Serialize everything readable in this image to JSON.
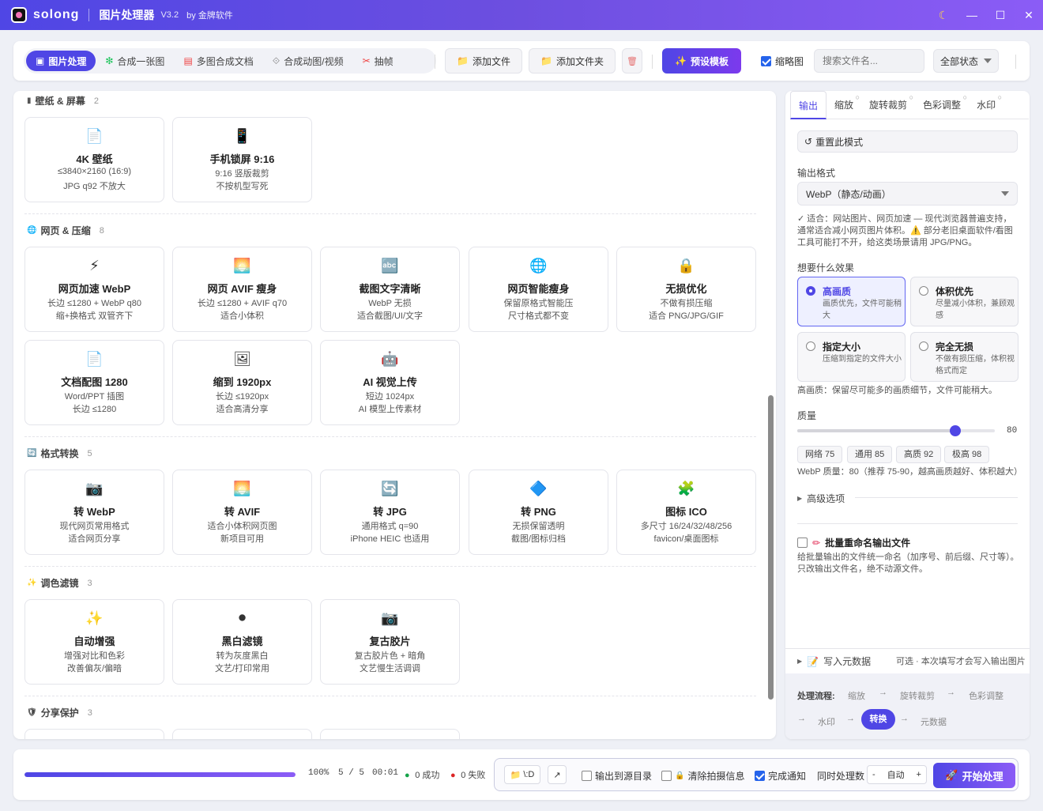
{
  "app": {
    "brand": "solong",
    "title": "图片处理器",
    "version": "V3.2",
    "by": "by 金牌软件"
  },
  "window": {
    "theme_glyph": "☾",
    "min_glyph": "—",
    "max_glyph": "☐",
    "close_glyph": "✕"
  },
  "modes": [
    {
      "label": "图片处理",
      "icon": "▣",
      "active": true
    },
    {
      "label": "合成一张图",
      "icon": "❇"
    },
    {
      "label": "多图合成文档",
      "icon": "▤"
    },
    {
      "label": "合成动图/视频",
      "icon": "⟐"
    },
    {
      "label": "抽帧",
      "icon": "✂"
    }
  ],
  "toolbar": {
    "add_file": "添加文件",
    "add_folder": "添加文件夹",
    "delete_glyph": "🗑",
    "preset": "预设模板",
    "thumb": "缩略图",
    "search_placeholder": "搜索文件名...",
    "status": "全部状态"
  },
  "sections": [
    {
      "title": "壁纸 & 屏幕",
      "count": "2",
      "icon": "▮",
      "cards": [
        {
          "icon": "📄",
          "title": "4K 壁纸",
          "d1": "≤3840×2160 (16:9)",
          "d2": "JPG q92 不放大"
        },
        {
          "icon": "📱",
          "title": "手机锁屏 9:16",
          "d1": "9:16 竖版裁剪",
          "d2": "不按机型写死"
        }
      ]
    },
    {
      "title": "网页 & 压缩",
      "count": "8",
      "icon": "🌐",
      "cards": [
        {
          "icon": "⚡",
          "title": "网页加速 WebP",
          "d1": "长边 ≤1280 + WebP q80",
          "d2": "缩+换格式 双管齐下"
        },
        {
          "icon": "🌅",
          "title": "网页 AVIF 瘦身",
          "d1": "长边 ≤1280 + AVIF q70",
          "d2": "适合小体积"
        },
        {
          "icon": "🔤",
          "title": "截图文字清晰",
          "d1": "WebP 无损",
          "d2": "适合截图/UI/文字"
        },
        {
          "icon": "🌐",
          "title": "网页智能瘦身",
          "d1": "保留原格式智能压",
          "d2": "尺寸格式都不变"
        },
        {
          "icon": "🔒",
          "title": "无损优化",
          "d1": "不做有损压缩",
          "d2": "适合 PNG/JPG/GIF"
        },
        {
          "icon": "📄",
          "title": "文档配图 1280",
          "d1": "Word/PPT 插图",
          "d2": "长边 ≤1280"
        },
        {
          "icon": "🖼",
          "title": "缩到 1920px",
          "d1": "长边 ≤1920px",
          "d2": "适合高清分享"
        },
        {
          "icon": "🤖",
          "title": "AI 视觉上传",
          "d1": "短边 1024px",
          "d2": "AI 模型上传素材"
        }
      ]
    },
    {
      "title": "格式转换",
      "count": "5",
      "icon": "🔄",
      "cards": [
        {
          "icon": "📷",
          "title": "转 WebP",
          "d1": "现代网页常用格式",
          "d2": "适合网页分享"
        },
        {
          "icon": "🌅",
          "title": "转 AVIF",
          "d1": "适合小体积网页图",
          "d2": "新项目可用"
        },
        {
          "icon": "🔄",
          "title": "转 JPG",
          "d1": "通用格式 q=90",
          "d2": "iPhone HEIC 也适用"
        },
        {
          "icon": "🔷",
          "title": "转 PNG",
          "d1": "无损保留透明",
          "d2": "截图/图标归档"
        },
        {
          "icon": "🧩",
          "title": "图标 ICO",
          "d1": "多尺寸 16/24/32/48/256",
          "d2": "favicon/桌面图标"
        }
      ]
    },
    {
      "title": "调色滤镜",
      "count": "3",
      "icon": "✨",
      "cards": [
        {
          "icon": "✨",
          "title": "自动增强",
          "d1": "增强对比和色彩",
          "d2": "改善偏灰/偏暗"
        },
        {
          "icon": "⚫",
          "title": "黑白滤镜",
          "d1": "转为灰度黑白",
          "d2": "文艺/打印常用"
        },
        {
          "icon": "📷",
          "title": "复古胶片",
          "d1": "复古胶片色 + 暗角",
          "d2": "文艺慢生活调调"
        }
      ]
    },
    {
      "title": "分享保护",
      "count": "3",
      "icon": "🛡",
      "cards": []
    }
  ],
  "right": {
    "tabs": [
      {
        "label": "输出",
        "active": true
      },
      {
        "label": "缩放",
        "mark": "○"
      },
      {
        "label": "旋转裁剪",
        "mark": "○"
      },
      {
        "label": "色彩调整",
        "mark": "○"
      },
      {
        "label": "水印",
        "mark": "○"
      }
    ],
    "reset": "重置此模式",
    "format_label": "输出格式",
    "format_value": "WebP（静态/动画）",
    "format_note": "✓ 适合：网站图片、网页加速 — 现代浏览器普遍支持，通常适合减小网页图片体积。⚠️ 部分老旧桌面软件/看图工具可能打不开，给这类场景请用 JPG/PNG。",
    "effect_label": "想要什么效果",
    "options": [
      {
        "title": "高画质",
        "desc": "画质优先，文件可能稍大",
        "selected": true
      },
      {
        "title": "体积优先",
        "desc": "尽量减小体积，兼顾观感"
      },
      {
        "title": "指定大小",
        "desc": "压缩到指定的文件大小"
      },
      {
        "title": "完全无损",
        "desc": "不做有损压缩，体积视格式而定"
      }
    ],
    "effect_note": "高画质：保留尽可能多的画质细节，文件可能稍大。",
    "quality_label": "质量",
    "quality": 80,
    "quality_max": 100,
    "quality_presets": [
      "网络 75",
      "通用 85",
      "高质 92",
      "极高 98"
    ],
    "quality_note": "WebP 质量：80（推荐 75-90，越高画质越好、体积越大）",
    "advanced": "高级选项",
    "rename_title": "批量重命名输出文件",
    "rename_note": "给批量输出的文件统一命名（加序号、前后缀、尺寸等）。只改输出文件名，绝不动源文件。",
    "metadata": "写入元数据",
    "metadata_note": "可选 · 本次填写才会写入输出图片",
    "flow_label": "处理流程:",
    "flow": [
      "缩放",
      "旋转裁剪",
      "色彩调整",
      "水印",
      "转换",
      "元数据"
    ]
  },
  "bottom": {
    "progress": 1.0,
    "percent": "100%",
    "count": "5 / 5",
    "time": "00:01",
    "success": "0 成功",
    "fail": "0 失败",
    "path": "\\:D",
    "out_to_source": "输出到源目录",
    "clear_exif": "清除拍摄信息",
    "notify": "完成通知",
    "concurrency_label": "同时处理数",
    "minus": "-",
    "concurrency": "自动",
    "plus": "+",
    "start": "开始处理"
  },
  "colors": {
    "accent": "#4f46e5",
    "success": "#16a34a",
    "fail": "#dc2626"
  }
}
